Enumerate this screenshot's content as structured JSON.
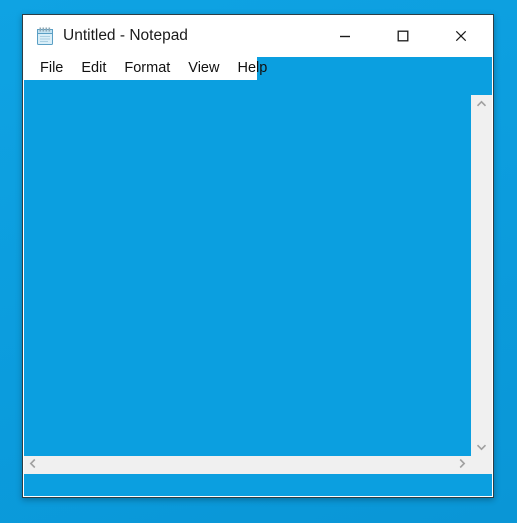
{
  "desktop": {
    "background_color": "#0b9fe0"
  },
  "window": {
    "title": "Untitled - Notepad",
    "icon": "notepad-icon",
    "border_color": "#2c3e46",
    "titlebar_background": "#ffffff",
    "controls": {
      "minimize_label": "Minimize",
      "maximize_label": "Maximize",
      "close_label": "Close",
      "minimize_icon": "minimize-icon",
      "maximize_icon": "maximize-icon",
      "close_icon": "close-icon"
    },
    "menu": {
      "items": [
        {
          "label": "File"
        },
        {
          "label": "Edit"
        },
        {
          "label": "Format"
        },
        {
          "label": "View"
        },
        {
          "label": "Help"
        }
      ]
    },
    "editor": {
      "content": "",
      "background_color": "#0b9fe0"
    },
    "scrollbars": {
      "track_color": "#f0f0f0",
      "arrow_color": "#a0a0a0",
      "vertical": {
        "up_icon": "chevron-up-icon",
        "down_icon": "chevron-down-icon"
      },
      "horizontal": {
        "left_icon": "chevron-left-icon",
        "right_icon": "chevron-right-icon"
      }
    }
  }
}
